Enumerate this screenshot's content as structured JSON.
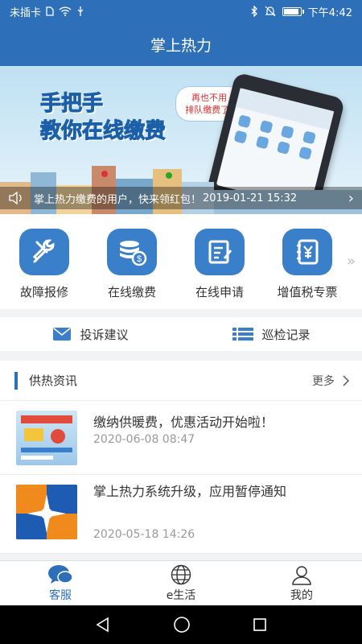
{
  "status_bar": {
    "carrier": "未插卡",
    "time": "下午4:42",
    "battery_level": 0.85
  },
  "header": {
    "title": "掌上热力"
  },
  "banner": {
    "slogan_line1": "手把手",
    "slogan_line2": "教你在线缴费",
    "bubble_line1": "再也不用",
    "bubble_line2": "排队缴费了!",
    "notice_text": "掌上热力缴费的用户，快来领红包！",
    "notice_date": "2019-01-21 15:32"
  },
  "services": [
    {
      "label": "故障报修",
      "icon": "wrench-screwdriver-icon"
    },
    {
      "label": "在线缴费",
      "icon": "coin-stack-icon"
    },
    {
      "label": "在线申请",
      "icon": "edit-document-icon"
    },
    {
      "label": "增值税专票",
      "icon": "yen-notebook-icon"
    }
  ],
  "links": [
    {
      "label": "投诉建议",
      "icon": "mail-icon"
    },
    {
      "label": "巡检记录",
      "icon": "list-icon"
    }
  ],
  "news": {
    "section_title": "供热资讯",
    "more_label": "更多",
    "items": [
      {
        "title": "缴纳供暖费，优惠活动开始啦！",
        "time": "2020-06-08 08:47"
      },
      {
        "title": "掌上热力系统升级，应用暂停通知",
        "time": "2020-05-18 14:26"
      }
    ]
  },
  "tabbar": [
    {
      "label": "客服",
      "icon": "chat-bubble-icon",
      "active": true
    },
    {
      "label": "e生活",
      "icon": "globe-icon",
      "active": false
    },
    {
      "label": "我的",
      "icon": "user-icon",
      "active": false
    }
  ],
  "colors": {
    "primary": "#2d6fb8",
    "icon_bg": "#3a7fca"
  }
}
